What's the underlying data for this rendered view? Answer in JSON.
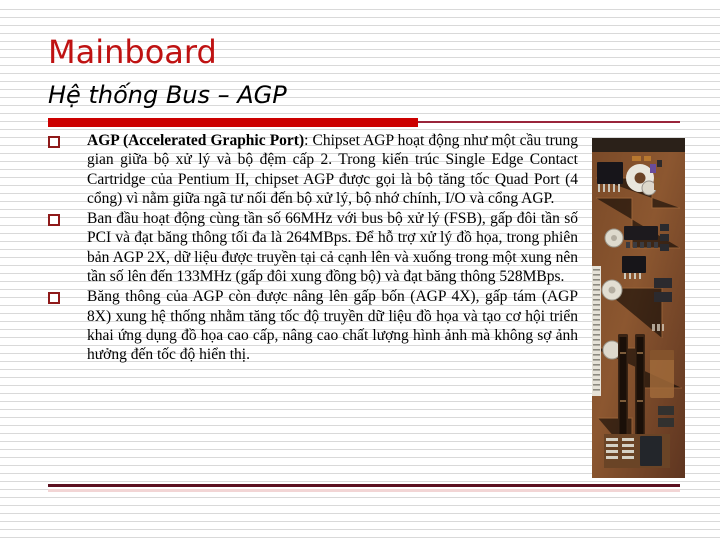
{
  "slide": {
    "title": "Mainboard",
    "subtitle": "Hệ thống Bus – AGP",
    "title_color": "#bf1212",
    "rule_color": "#cc0000",
    "bullet_color": "#8f1a1a"
  },
  "bullets": [
    {
      "lead": "AGP (Accelerated Graphic Port)",
      "text": ": Chipset AGP hoạt động như một cầu trung gian giữa bộ xử lý và bộ đệm cấp 2. Trong kiến trúc Single Edge Contact Cartridge của Pentium II, chipset AGP được gọi là bộ tăng tốc Quad Port (4 cổng) vì nằm giữa ngã tư nối đến bộ xử lý, bộ nhớ chính, I/O và cổng AGP."
    },
    {
      "lead": "",
      "text": "Ban đầu hoạt động cùng tần số 66MHz với bus bộ xử lý (FSB), gấp đôi tần số PCI và đạt băng thông tối đa là 264MBps. Để hỗ trợ xử lý đồ họa, trong phiên bản AGP 2X, dữ liệu được truyền tại cả cạnh lên và xuống trong một xung nên tần số lên đến 133MHz (gấp đôi xung đồng bộ) và đạt băng thông 528MBps."
    },
    {
      "lead": "",
      "text": "Băng thông của AGP còn được nâng lên gấp bốn (AGP 4X), gấp tám (AGP 8X) xung hệ thống nhằm tăng tốc độ truyền dữ liệu đồ họa và tạo cơ hội triển khai ứng dụng đồ họa cao cấp, nâng cao chất lượng hình ảnh mà không sợ ảnh hưởng đến tốc độ hiển thị."
    }
  ],
  "image": {
    "name": "motherboard-photo",
    "alt": "Ảnh bo mạch chủ với khe cắm AGP và PCI"
  }
}
